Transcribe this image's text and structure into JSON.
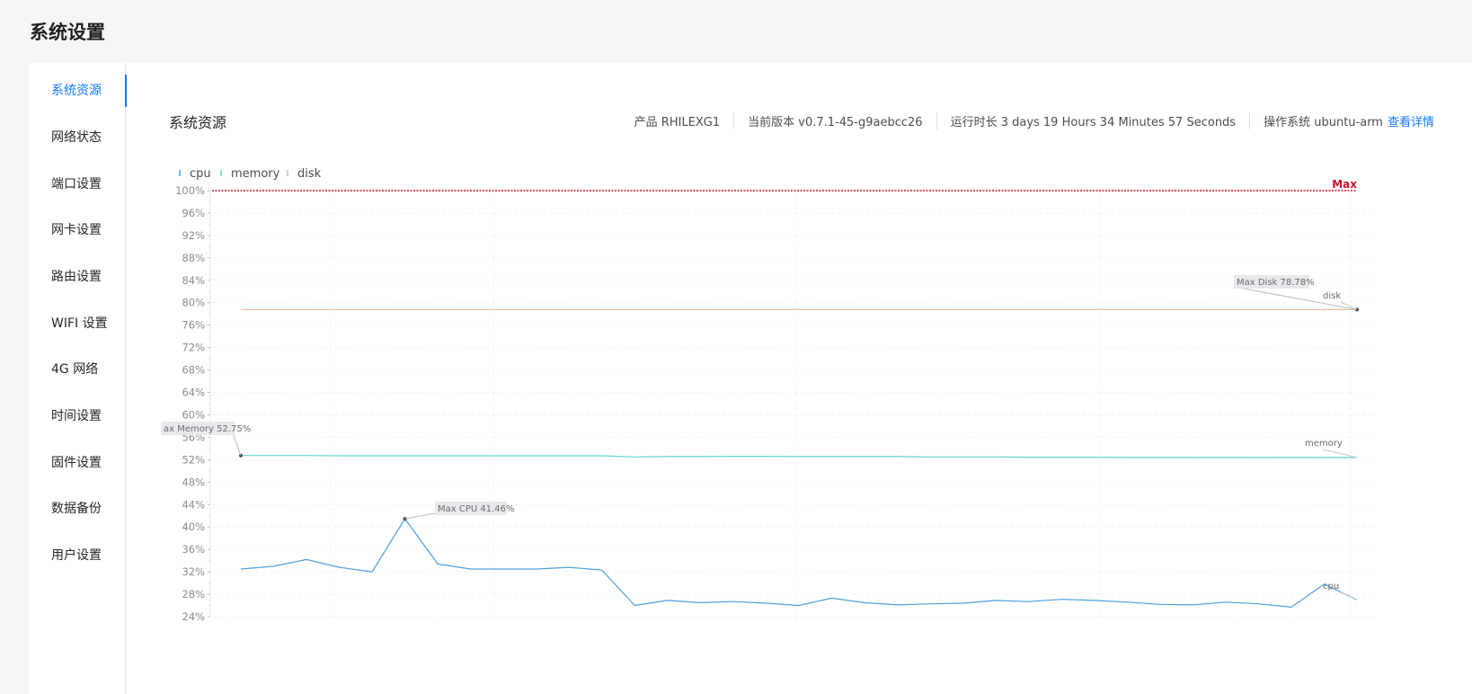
{
  "page_title": "系统设置",
  "sidebar": {
    "items": [
      {
        "label": "系统资源",
        "active": true
      },
      {
        "label": "网络状态"
      },
      {
        "label": "端口设置"
      },
      {
        "label": "网卡设置"
      },
      {
        "label": "路由设置"
      },
      {
        "label": "WIFI 设置"
      },
      {
        "label": "4G  网络"
      },
      {
        "label": "时间设置"
      },
      {
        "label": "固件设置"
      },
      {
        "label": "数据备份"
      },
      {
        "label": "用户设置"
      }
    ]
  },
  "main": {
    "section_title": "系统资源",
    "info": {
      "product": "产品 RHILEXG1",
      "version": "当前版本 v0.7.1-45-g9aebcc26",
      "uptime": "运行时长 3 days 19 Hours 34 Minutes 57 Seconds",
      "os": "操作系统 ubuntu-arm",
      "details_link": "查看详情"
    }
  },
  "colors": {
    "accent": "#1677ff",
    "cpu": "#4e9fdc",
    "memory": "#5ed6c8",
    "disk": "#e3b59a",
    "max_line": "#c8102e"
  },
  "chart_data": {
    "type": "line",
    "legend": [
      "cpu",
      "memory",
      "disk"
    ],
    "legend_position": "top-left",
    "grid": true,
    "ylim": [
      24,
      100
    ],
    "y_ticks": [
      "24%",
      "28%",
      "32%",
      "36%",
      "40%",
      "44%",
      "48%",
      "52%",
      "56%",
      "60%",
      "64%",
      "68%",
      "72%",
      "76%",
      "80%",
      "84%",
      "88%",
      "92%",
      "96%",
      "100%"
    ],
    "max_line": {
      "value": 100,
      "label": "Max"
    },
    "series": [
      {
        "name": "cpu",
        "values": [
          32.5,
          33.0,
          34.2,
          32.8,
          32.0,
          41.46,
          33.4,
          32.5,
          32.5,
          32.5,
          32.8,
          32.3,
          26.0,
          26.9,
          26.5,
          26.7,
          26.4,
          26.0,
          27.3,
          26.5,
          26.1,
          26.3,
          26.4,
          26.9,
          26.7,
          27.1,
          26.9,
          26.6,
          26.2,
          26.1,
          26.6,
          26.3,
          25.7,
          29.8,
          27.0
        ],
        "max_label": "Max CPU 41.46%",
        "end_label": "cpu"
      },
      {
        "name": "memory",
        "values": [
          52.75,
          52.75,
          52.75,
          52.7,
          52.7,
          52.7,
          52.7,
          52.7,
          52.7,
          52.7,
          52.7,
          52.7,
          52.5,
          52.55,
          52.55,
          52.6,
          52.6,
          52.55,
          52.55,
          52.55,
          52.55,
          52.5,
          52.5,
          52.5,
          52.45,
          52.45,
          52.45,
          52.4,
          52.4,
          52.4,
          52.4,
          52.4,
          52.4,
          52.4,
          52.4
        ],
        "max_label": "ax Memory 52.75%",
        "end_label": "memory"
      },
      {
        "name": "disk",
        "values": [
          78.78,
          78.78,
          78.78,
          78.78,
          78.78,
          78.78,
          78.78,
          78.78,
          78.78,
          78.78,
          78.78,
          78.78,
          78.78,
          78.78,
          78.78,
          78.78,
          78.78,
          78.78,
          78.78,
          78.78,
          78.78,
          78.78,
          78.78,
          78.78,
          78.78,
          78.78,
          78.78,
          78.78,
          78.78,
          78.78,
          78.78,
          78.78,
          78.78,
          78.78,
          78.78
        ],
        "max_label": "Max Disk 78.78%",
        "end_label": "disk"
      }
    ]
  }
}
